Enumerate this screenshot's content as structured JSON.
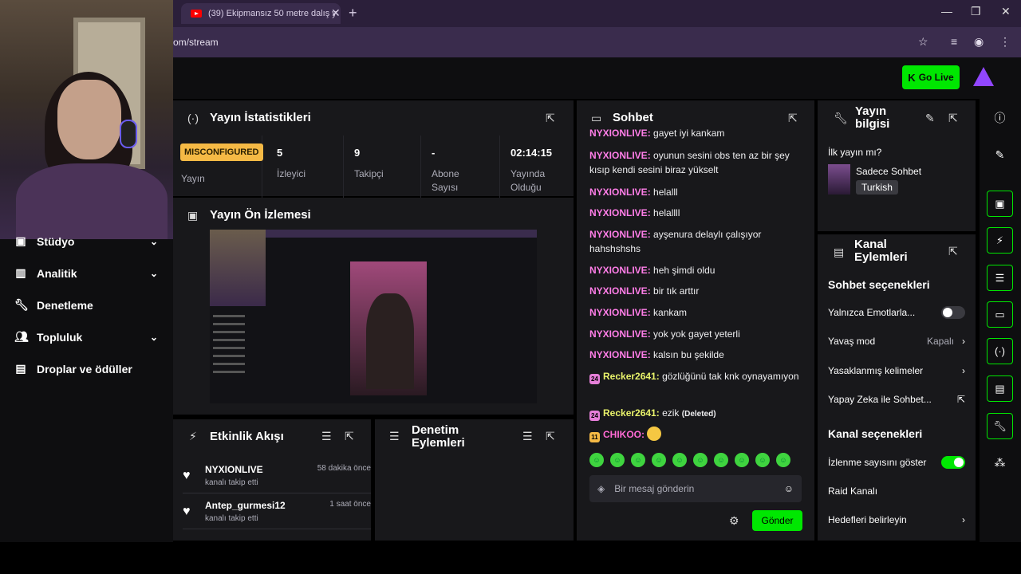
{
  "browser": {
    "tab_title": "(39) Ekipmansız 50 metre dalış y",
    "url": "om/stream"
  },
  "header": {
    "go_live_label": "Go Live"
  },
  "nav": {
    "items": [
      {
        "label": "Stüdyo",
        "icon": "studio-icon"
      },
      {
        "label": "Analitik",
        "icon": "chart-icon"
      },
      {
        "label": "Denetleme",
        "icon": "wrench-icon"
      },
      {
        "label": "Topluluk",
        "icon": "users-icon"
      },
      {
        "label": "Droplar ve ödüller",
        "icon": "gift-icon"
      }
    ]
  },
  "stats": {
    "title": "Yayın İstatistikleri",
    "status_badge": "MISCONFIGURED",
    "cells": [
      {
        "value": "",
        "label": "Yayın"
      },
      {
        "value": "5",
        "label": "İzleyici"
      },
      {
        "value": "9",
        "label": "Takipçi"
      },
      {
        "value": "-",
        "label": "Abone Sayısı"
      },
      {
        "value": "02:14:15",
        "label": "Yayında Olduğu"
      }
    ]
  },
  "preview": {
    "title": "Yayın Ön İzlemesi"
  },
  "activity": {
    "title": "Etkinlik Akışı",
    "events": [
      {
        "user": "NYXIONLIVE",
        "action": "kanalı takip etti",
        "time": "58 dakika önce"
      },
      {
        "user": "Antep_gurmesi12",
        "action": "kanalı takip etti",
        "time": "1 saat önce"
      }
    ]
  },
  "mod_actions": {
    "title": "Denetim Eylemleri"
  },
  "chat": {
    "title": "Sohbet",
    "messages": [
      {
        "user": "NYXIONLIVE",
        "text": "gayet iyi kankam"
      },
      {
        "user": "NYXIONLIVE",
        "text": "oyunun sesini obs ten az bir şey kısıp kendi sesini biraz yükselt"
      },
      {
        "user": "NYXIONLIVE",
        "text": "helalll"
      },
      {
        "user": "NYXIONLIVE",
        "text": "helallll"
      },
      {
        "user": "NYXIONLIVE",
        "text": "ayşenura delaylı çalışıyor hahshshshs"
      },
      {
        "user": "NYXIONLIVE",
        "text": "heh şimdi oldu"
      },
      {
        "user": "NYXIONLIVE",
        "text": "bir tık arttır"
      },
      {
        "user": "NYXIONLIVE",
        "text": "kankam"
      },
      {
        "user": "NYXIONLIVE",
        "text": "yok yok gayet yeterli"
      },
      {
        "user": "NYXIONLIVE",
        "text": "kalsın bu şekilde"
      },
      {
        "user": "Recker2641",
        "badge": "24",
        "text": "gözlüğünü tak knk oynayamıyon"
      },
      {
        "user": "Recker2641",
        "badge": "24",
        "text": "ezik",
        "note": "(Deleted)"
      },
      {
        "user": "CHIKOO",
        "badge": "11",
        "text": ""
      }
    ],
    "input_placeholder": "Bir mesaj gönderin",
    "send_label": "Gönder"
  },
  "stream_info": {
    "title": "Yayın bilgisi",
    "first_stream_label": "İlk yayın mı?",
    "category": "Sadece Sohbet",
    "language": "Turkish"
  },
  "channel_actions": {
    "title": "Kanal Eylemleri",
    "chat_options_title": "Sohbet seçenekleri",
    "emote_only_label": "Yalnızca Emotlarla...",
    "slow_mode_label": "Yavaş mod",
    "slow_mode_value": "Kapalı",
    "banned_words_label": "Yasaklanmış kelimeler",
    "ai_chat_label": "Yapay Zeka ile Sohbet...",
    "channel_options_title": "Kanal seçenekleri",
    "show_viewers_label": "İzlenme sayısını göster",
    "raid_label": "Raid Kanalı",
    "goals_label": "Hedefleri belirleyin"
  },
  "colors": {
    "accent": "#00e701",
    "nyxion": "#ff7ee8",
    "recker": "#e9f36b",
    "chikoo": "#ff6ad5",
    "badge": "#f5b945"
  }
}
